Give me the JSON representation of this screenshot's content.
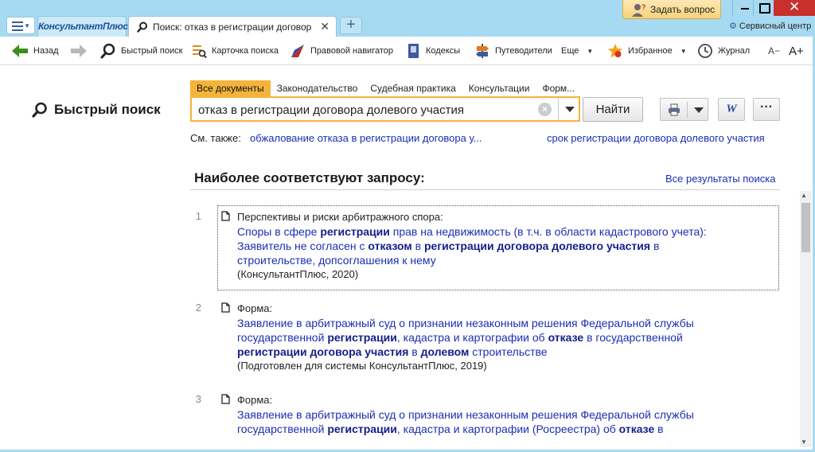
{
  "titlebar": {
    "brand": "КонсультантПлюс",
    "tab_title": "Поиск: отказ в регистрации договора долевого участия",
    "ask_question": "Задать вопрос",
    "service_center": "Сервисный центр"
  },
  "toolbar": {
    "back": "Назад",
    "quick_search": "Быстрый поиск",
    "search_card": "Карточка поиска",
    "legal_navigator": "Правовой навигатор",
    "codes": "Кодексы",
    "guides": "Путеводители",
    "more": "Еще",
    "favorites": "Избранное",
    "journal": "Журнал",
    "font_smaller": "A−",
    "font_larger": "A+"
  },
  "search": {
    "page_title": "Быстрый поиск",
    "tabs": [
      "Все документы",
      "Законодательство",
      "Судебная практика",
      "Консультации",
      "Форм..."
    ],
    "active_tab": 0,
    "query": "отказ в регистрации договора долевого участия",
    "find_button": "Найти",
    "word_label": "W",
    "more_label": "···",
    "see_also_label": "См. также:",
    "see_also": [
      "обжалование отказа в регистрации договора у...",
      "срок регистрации договора долевого участия"
    ]
  },
  "results": {
    "header": "Наиболее соответствуют запросу:",
    "all_results": "Все результаты поиска",
    "items": [
      {
        "num": "1",
        "category": "Перспективы и риски арбитражного спора:",
        "title_lines": [
          [
            [
              "t",
              "Споры в сфере "
            ],
            [
              "b",
              "регистрации"
            ],
            [
              "t",
              " прав на недвижимость (в т.ч. в области кадастрового учета):"
            ]
          ],
          [
            [
              "t",
              "Заявитель не согласен с "
            ],
            [
              "b",
              "отказом"
            ],
            [
              "t",
              " в "
            ],
            [
              "b",
              "регистрации договора долевого участия"
            ],
            [
              "t",
              " в"
            ]
          ],
          [
            [
              "t",
              "строительстве, допсоглашения к нему"
            ]
          ]
        ],
        "source": "(КонсультантПлюс, 2020)"
      },
      {
        "num": "2",
        "category": "Форма:",
        "title_lines": [
          [
            [
              "t",
              "Заявление в арбитражный суд о признании незаконным решения Федеральной службы"
            ]
          ],
          [
            [
              "t",
              "государственной "
            ],
            [
              "b",
              "регистрации"
            ],
            [
              "t",
              ", кадастра и картографии об "
            ],
            [
              "b",
              "отказе"
            ],
            [
              "t",
              " в государственной"
            ]
          ],
          [
            [
              "b",
              "регистрации договора участия"
            ],
            [
              "t",
              " в "
            ],
            [
              "b",
              "долевом"
            ],
            [
              "t",
              " строительстве"
            ]
          ]
        ],
        "source": "(Подготовлен для системы КонсультантПлюс, 2019)"
      },
      {
        "num": "3",
        "category": "Форма:",
        "title_lines": [
          [
            [
              "t",
              "Заявление в арбитражный суд о признании незаконным решения Федеральной службы"
            ]
          ],
          [
            [
              "t",
              "государственной "
            ],
            [
              "b",
              "регистрации"
            ],
            [
              "t",
              ", кадастра и картографии (Росреестра) об "
            ],
            [
              "b",
              "отказе"
            ],
            [
              "t",
              " в"
            ]
          ]
        ],
        "source": ""
      }
    ]
  },
  "colors": {
    "titlebar_bg": "#a6daf2",
    "accent_orange": "#f4b43c",
    "link_blue": "#1a2fb3",
    "close_red": "#c9302c"
  }
}
